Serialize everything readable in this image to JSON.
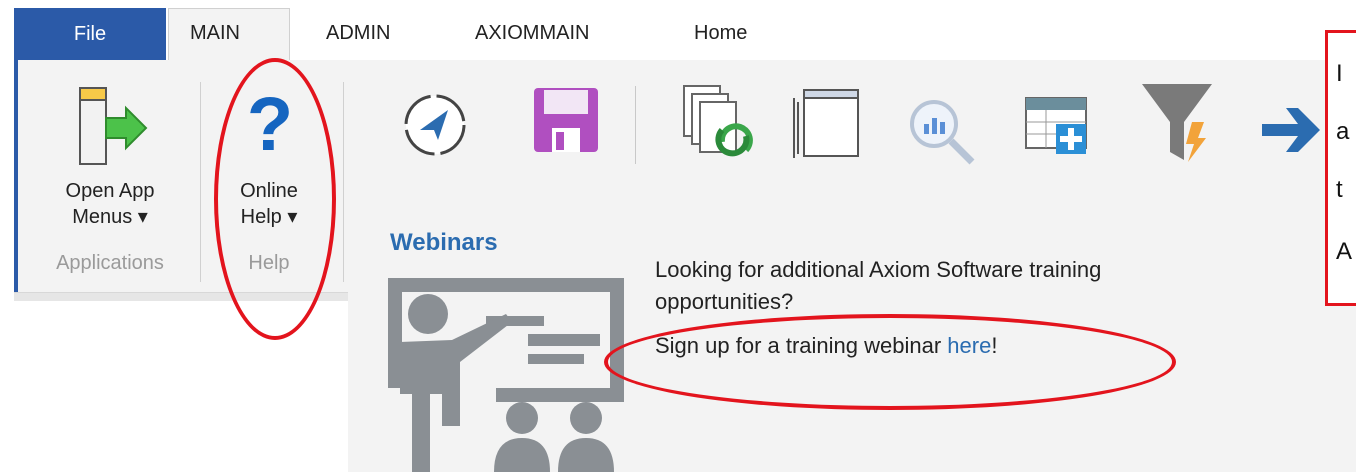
{
  "ribbon": {
    "tabs": [
      {
        "label": "File"
      },
      {
        "label": "MAIN"
      },
      {
        "label": "ADMIN"
      },
      {
        "label": "AXIOMMAIN"
      },
      {
        "label": "Home"
      }
    ],
    "open_app": {
      "line1": "Open App",
      "line2": "Menus ▾"
    },
    "online_help": {
      "line1": "Online",
      "line2": "Help ▾"
    },
    "groups": {
      "applications": "Applications",
      "help": "Help"
    },
    "toolbar_icons": [
      "navigate-icon",
      "save-icon",
      "refresh-documents-icon",
      "window-icon",
      "search-chart-icon",
      "add-table-icon",
      "filter-icon",
      "arrow-right-icon"
    ]
  },
  "webinars": {
    "title": "Webinars",
    "line1": "Looking for additional Axiom Software training",
    "line2": "opportunities?",
    "signup_prefix": "Sign up for a training webinar ",
    "link_text": "here",
    "signup_suffix": "!"
  },
  "callout": {
    "letters": [
      "I",
      "a",
      "t",
      "A"
    ]
  },
  "colors": {
    "accent": "#2b5aa8",
    "link": "#2b6cb0",
    "highlight": "#e3141d",
    "ribbon_bg": "#f3f3f3"
  }
}
